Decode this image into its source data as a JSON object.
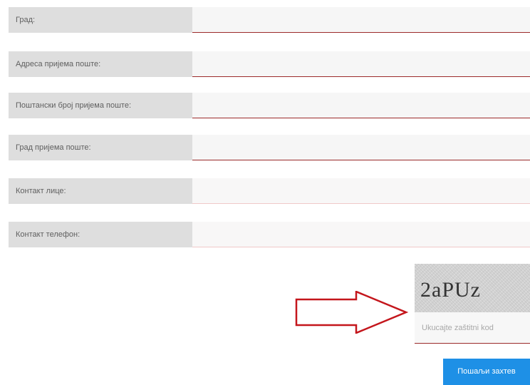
{
  "form": {
    "fields": [
      {
        "label": "Град:",
        "value": ""
      },
      {
        "label": "Адреса пријема поште:",
        "value": ""
      },
      {
        "label": "Поштански број пријема поште:",
        "value": ""
      },
      {
        "label": "Град пријема поште:",
        "value": ""
      },
      {
        "label": "Контакт лице:",
        "value": ""
      },
      {
        "label": "Контакт телефон:",
        "value": ""
      }
    ]
  },
  "captcha": {
    "code": "2aPUz",
    "placeholder": "Ukucajte zaštitni kod",
    "value": ""
  },
  "submit": {
    "label": "Пошаљи захтев"
  },
  "colors": {
    "label_bg": "#dedede",
    "field_bg": "#f6f6f6",
    "underline": "#9b2a2a",
    "arrow": "#c4161c",
    "button": "#1e90e6"
  }
}
